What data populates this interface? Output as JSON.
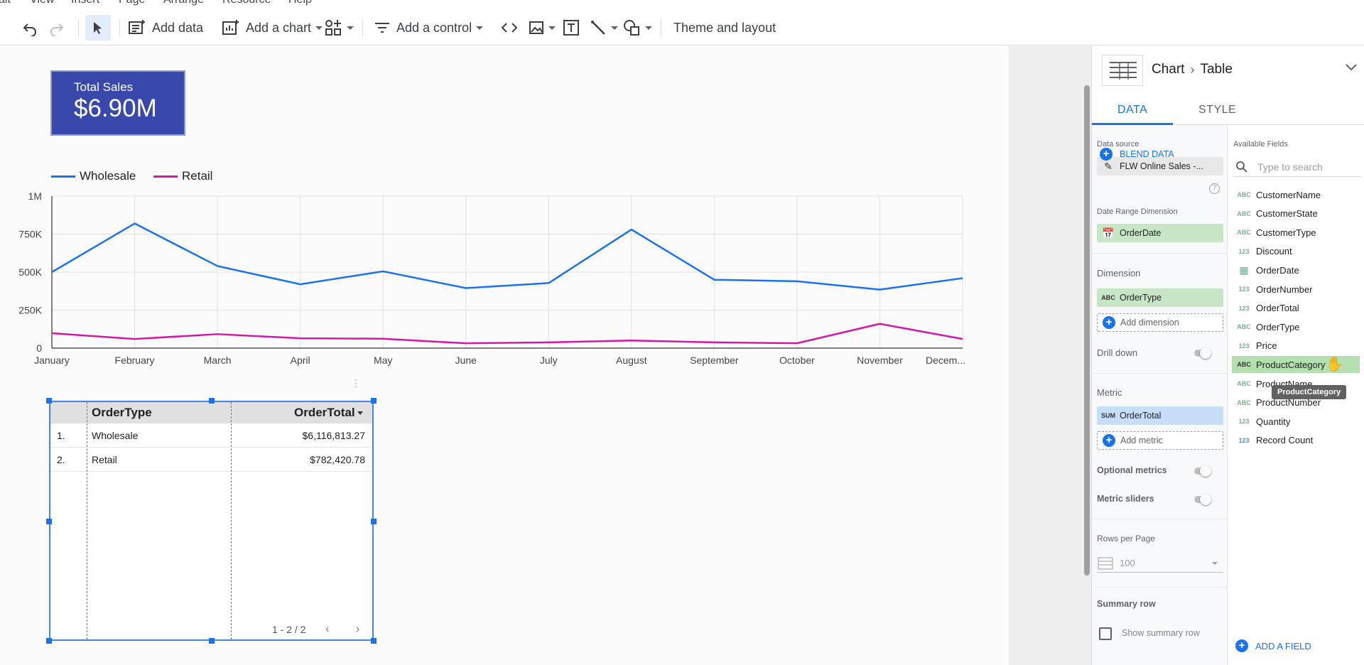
{
  "toolbar": {
    "add_data": "Add data",
    "add_chart": "Add a chart",
    "add_control": "Add a control",
    "theme_layout": "Theme and layout"
  },
  "menu": [
    "ait",
    "View",
    "Insert",
    "Page",
    "Arrange",
    "Resource",
    "Help"
  ],
  "scorecard": {
    "title": "Total Sales",
    "value": "$6.90M"
  },
  "chart_data": {
    "type": "line",
    "categories": [
      "January",
      "February",
      "March",
      "April",
      "May",
      "June",
      "July",
      "August",
      "September",
      "October",
      "November",
      "Decem..."
    ],
    "series": [
      {
        "name": "Wholesale",
        "color": "#1a73e8",
        "values": [
          500000,
          820000,
          540000,
          420000,
          505000,
          395000,
          428000,
          780000,
          450000,
          440000,
          385000,
          460000
        ]
      },
      {
        "name": "Retail",
        "color": "#d01aa5",
        "values": [
          98000,
          60000,
          92000,
          65000,
          62000,
          32000,
          38000,
          50000,
          38000,
          32000,
          160000,
          60000
        ]
      }
    ],
    "ytick_labels": [
      "0",
      "250K",
      "500K",
      "750K",
      "1M"
    ],
    "ylim": [
      0,
      1000000
    ],
    "legend": "top-left",
    "grid": true
  },
  "table": {
    "col1": "OrderType",
    "col2": "OrderTotal",
    "rows": [
      {
        "idx": "1.",
        "type": "Wholesale",
        "total": "$6,116,813.27"
      },
      {
        "idx": "2.",
        "type": "Retail",
        "total": "$782,420.78"
      }
    ],
    "pager": "1 - 2 / 2"
  },
  "panel": {
    "crumb_chart": "Chart",
    "crumb_table": "Table",
    "tab_data": "DATA",
    "tab_style": "STYLE",
    "data_source_label": "Data source",
    "data_source": "FLW Online Sales -...",
    "blend": "BLEND DATA",
    "date_range_label": "Date Range Dimension",
    "date_range": "OrderDate",
    "dimension_label": "Dimension",
    "dimension": "OrderType",
    "add_dimension": "Add dimension",
    "drill_down": "Drill down",
    "metric_label": "Metric",
    "metric_agg": "SUM",
    "metric": "OrderTotal",
    "add_metric": "Add metric",
    "optional_metrics": "Optional metrics",
    "metric_sliders": "Metric sliders",
    "rows_per_page_label": "Rows per Page",
    "rows_per_page": "100",
    "summary_row_label": "Summary row",
    "show_summary": "Show summary row",
    "available_fields_label": "Available Fields",
    "search_placeholder": "Type to search",
    "fields": [
      {
        "name": "CustomerName",
        "type": "ABC"
      },
      {
        "name": "CustomerState",
        "type": "ABC"
      },
      {
        "name": "CustomerType",
        "type": "ABC"
      },
      {
        "name": "Discount",
        "type": "123"
      },
      {
        "name": "OrderDate",
        "type": "DATE"
      },
      {
        "name": "OrderNumber",
        "type": "123"
      },
      {
        "name": "OrderTotal",
        "type": "123"
      },
      {
        "name": "OrderType",
        "type": "ABC"
      },
      {
        "name": "Price",
        "type": "123"
      },
      {
        "name": "ProductCategory",
        "type": "ABC"
      },
      {
        "name": "ProductName",
        "type": "ABC"
      },
      {
        "name": "ProductNumber",
        "type": "ABC"
      },
      {
        "name": "Quantity",
        "type": "123"
      },
      {
        "name": "Record Count",
        "type": "123"
      }
    ],
    "tooltip": "ProductCategory",
    "add_field": "ADD A FIELD"
  }
}
